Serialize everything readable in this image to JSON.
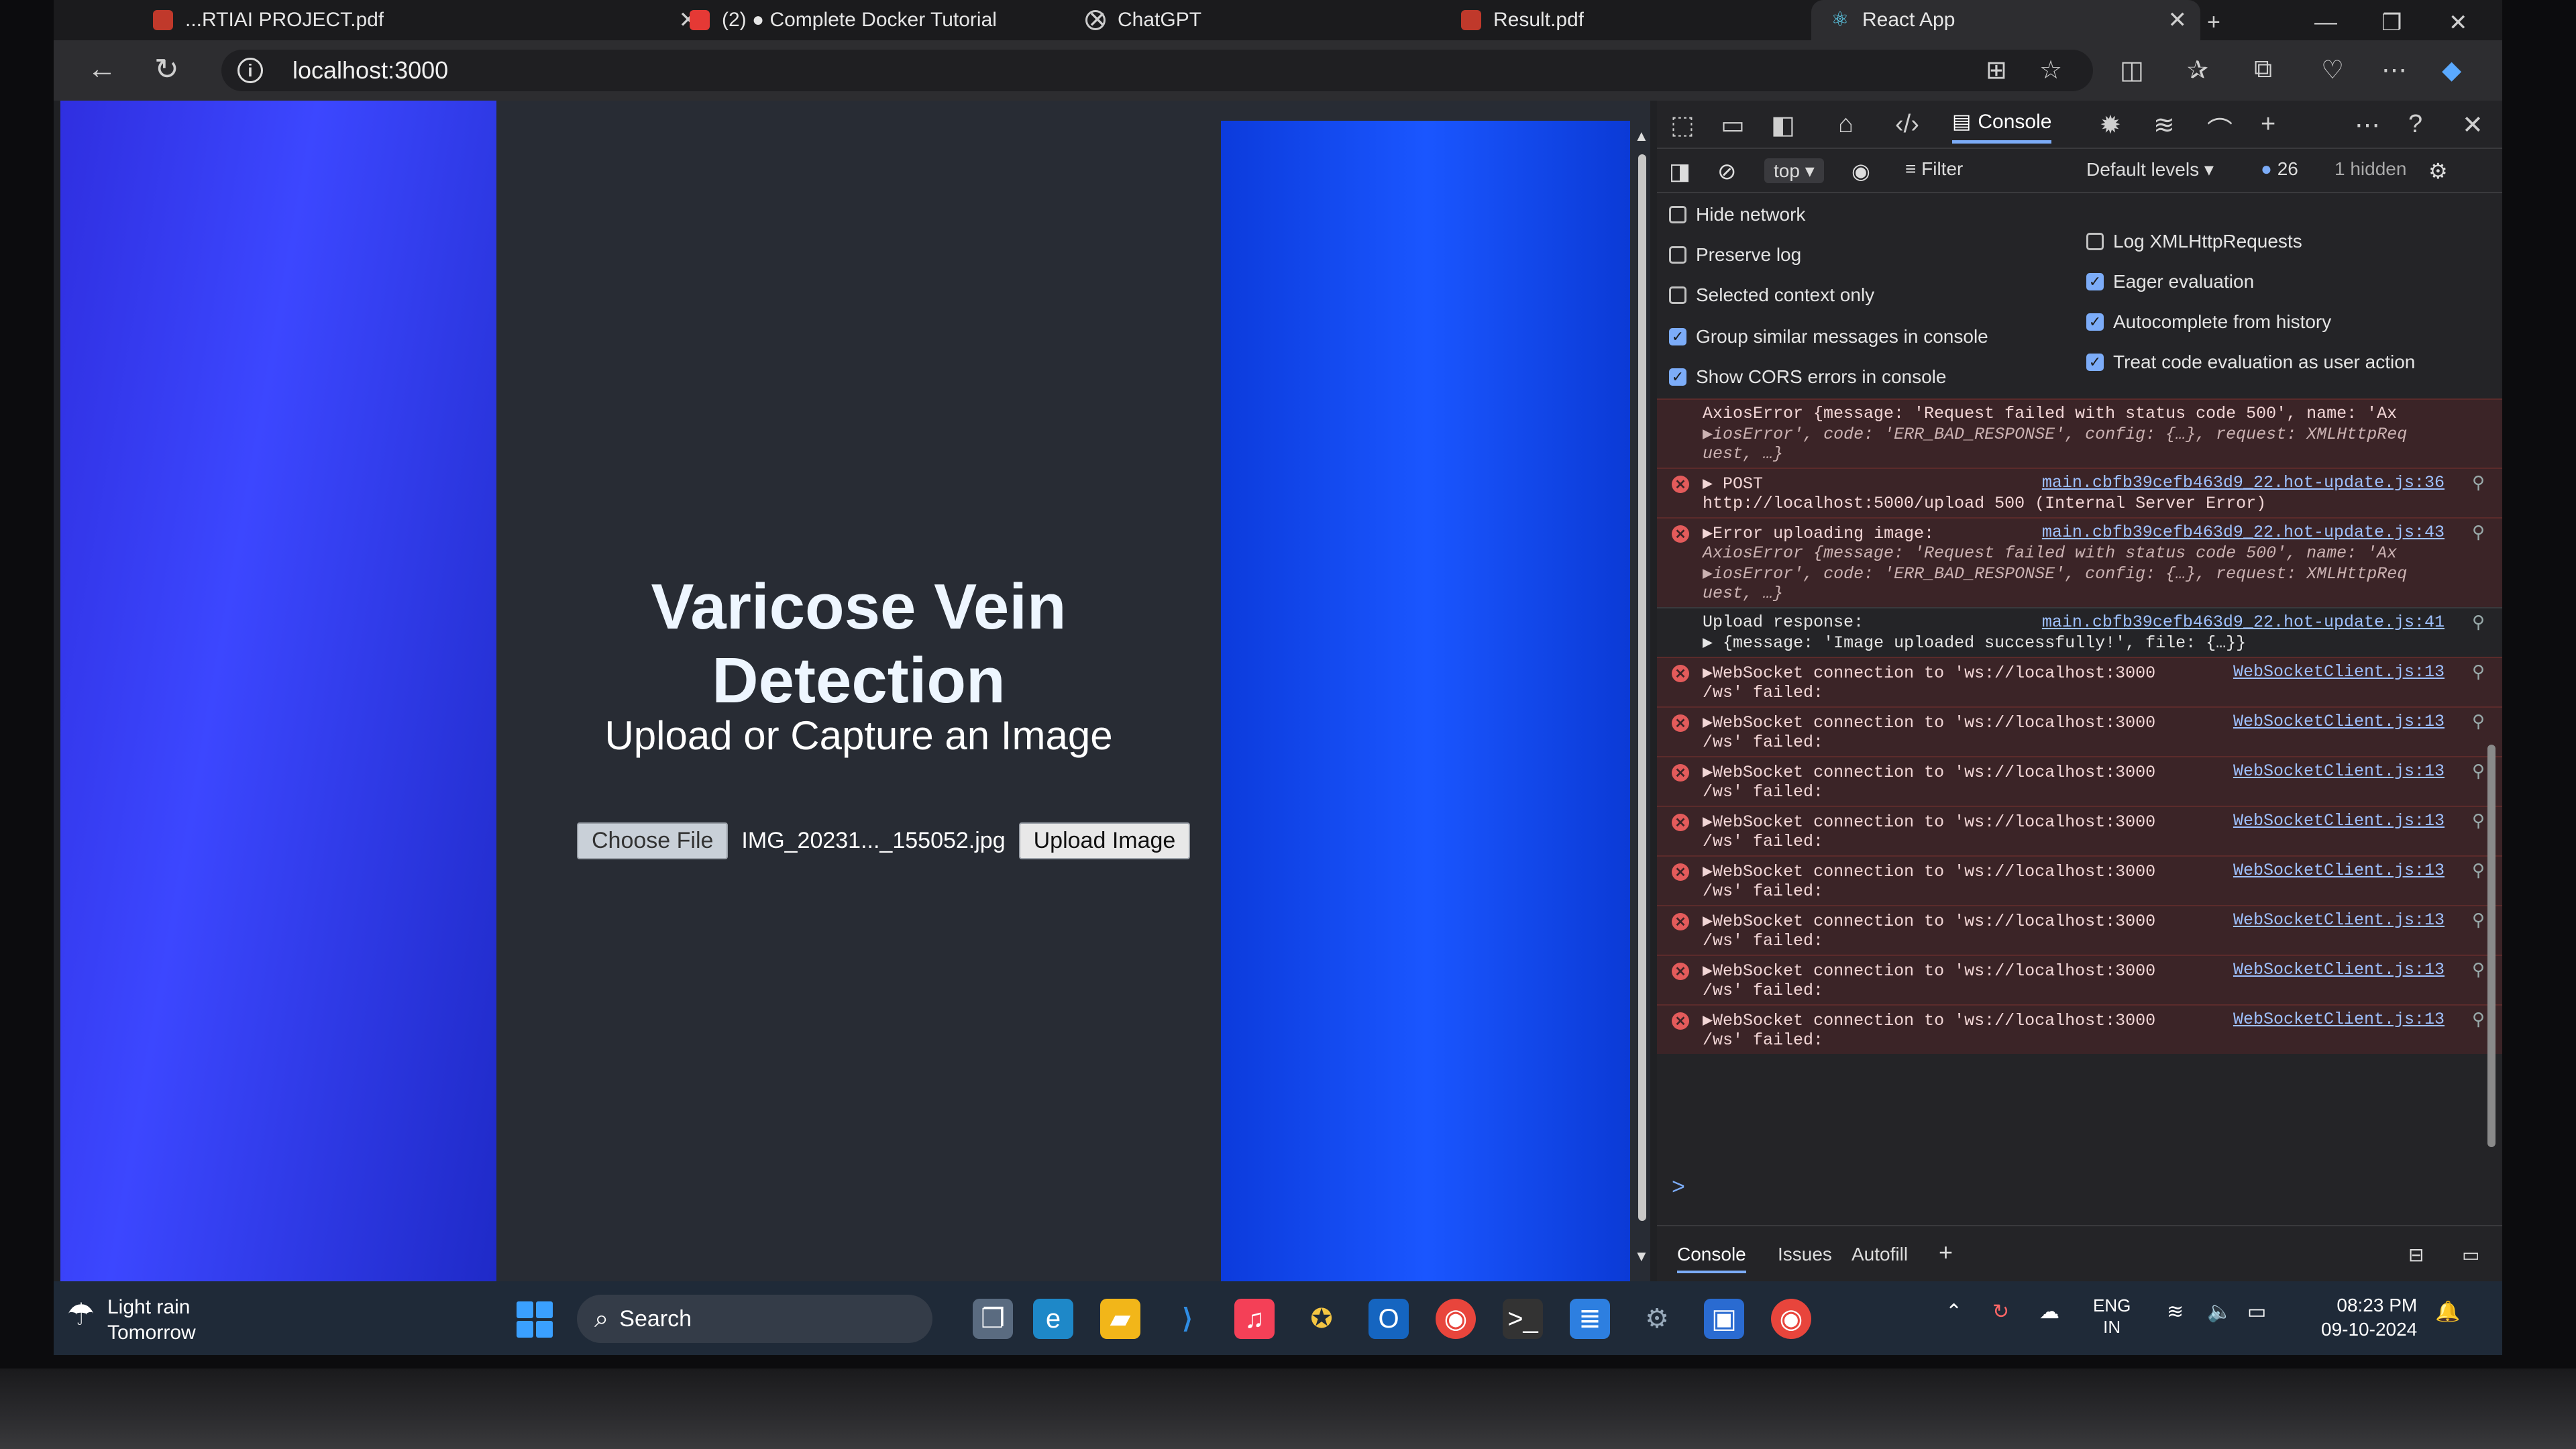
{
  "browser": {
    "tabs": [
      {
        "label": "...RTIAI PROJECT.pdf",
        "active": false
      },
      {
        "label": "(2) ● Complete Docker Tutorial",
        "active": false
      },
      {
        "label": "ChatGPT",
        "active": false
      },
      {
        "label": "Result.pdf",
        "active": false
      },
      {
        "label": "React App",
        "active": true
      }
    ],
    "new_tab": "+",
    "url": "localhost:3000"
  },
  "page": {
    "title": "Varicose Vein Detection",
    "subtitle": "Upload or Capture an Image",
    "choose_file_label": "Choose File",
    "file_name": "IMG_20231..._155052.jpg",
    "upload_label": "Upload Image"
  },
  "devtools": {
    "console_tab": "Console",
    "context": "top",
    "filter_placeholder": "Filter",
    "levels": "Default levels",
    "message_count": "26",
    "hidden": "1 hidden",
    "settings_left": [
      {
        "label": "Hide network",
        "checked": false
      },
      {
        "label": "Preserve log",
        "checked": false
      },
      {
        "label": "Selected context only",
        "checked": false
      },
      {
        "label": "Group similar messages in console",
        "checked": true
      },
      {
        "label": "Show CORS errors in console",
        "checked": true
      }
    ],
    "settings_right": [
      {
        "label": "Log XMLHttpRequests",
        "checked": false
      },
      {
        "label": "Eager evaluation",
        "checked": true
      },
      {
        "label": "Autocomplete from history",
        "checked": true
      },
      {
        "label": "Treat code evaluation as user action",
        "checked": true
      }
    ],
    "logs": [
      {
        "type": "error",
        "lines": [
          "AxiosError {message: 'Request failed with status code 500', name: 'Ax",
          "▶iosError', code: 'ERR_BAD_RESPONSE', config: {…}, request: XMLHttpReq",
          "uest, …}"
        ],
        "source": "",
        "continuation": true
      },
      {
        "type": "error",
        "lines": [
          "▶ POST",
          "http://localhost:5000/upload 500 (Internal Server Error)"
        ],
        "source": "main.cbfb39cefb463d9_22.hot-update.js:36"
      },
      {
        "type": "error",
        "lines": [
          "▶Error uploading image:",
          "AxiosError {message: 'Request failed with status code 500', name: 'Ax",
          "▶iosError', code: 'ERR_BAD_RESPONSE', config: {…}, request: XMLHttpReq",
          "uest, …}"
        ],
        "source": "main.cbfb39cefb463d9_22.hot-update.js:43"
      },
      {
        "type": "info",
        "lines": [
          "Upload response:",
          "▶ {message: 'Image uploaded successfully!', file: {…}}"
        ],
        "source": "main.cbfb39cefb463d9_22.hot-update.js:41"
      },
      {
        "type": "error",
        "lines": [
          "▶WebSocket connection to 'ws://localhost:3000",
          "/ws' failed:"
        ],
        "source": "WebSocketClient.js:13"
      },
      {
        "type": "error",
        "lines": [
          "▶WebSocket connection to 'ws://localhost:3000",
          "/ws' failed:"
        ],
        "source": "WebSocketClient.js:13"
      },
      {
        "type": "error",
        "lines": [
          "▶WebSocket connection to 'ws://localhost:3000",
          "/ws' failed:"
        ],
        "source": "WebSocketClient.js:13"
      },
      {
        "type": "error",
        "lines": [
          "▶WebSocket connection to 'ws://localhost:3000",
          "/ws' failed:"
        ],
        "source": "WebSocketClient.js:13"
      },
      {
        "type": "error",
        "lines": [
          "▶WebSocket connection to 'ws://localhost:3000",
          "/ws' failed:"
        ],
        "source": "WebSocketClient.js:13"
      },
      {
        "type": "error",
        "lines": [
          "▶WebSocket connection to 'ws://localhost:3000",
          "/ws' failed:"
        ],
        "source": "WebSocketClient.js:13"
      },
      {
        "type": "error",
        "lines": [
          "▶WebSocket connection to 'ws://localhost:3000",
          "/ws' failed:"
        ],
        "source": "WebSocketClient.js:13"
      },
      {
        "type": "error",
        "lines": [
          "▶WebSocket connection to 'ws://localhost:3000",
          "/ws' failed:"
        ],
        "source": "WebSocketClient.js:13"
      }
    ],
    "prompt": ">",
    "drawer_tabs": [
      "Console",
      "Issues",
      "Autofill"
    ]
  },
  "taskbar": {
    "weather_line1": "Light rain",
    "weather_line2": "Tomorrow",
    "search_label": "Search",
    "lang_line1": "ENG",
    "lang_line2": "IN",
    "time": "08:23 PM",
    "date": "09-10-2024"
  },
  "colors": {
    "error_bg": "#3b2427",
    "link": "#9ec1ff",
    "accent": "#7cacf8"
  }
}
